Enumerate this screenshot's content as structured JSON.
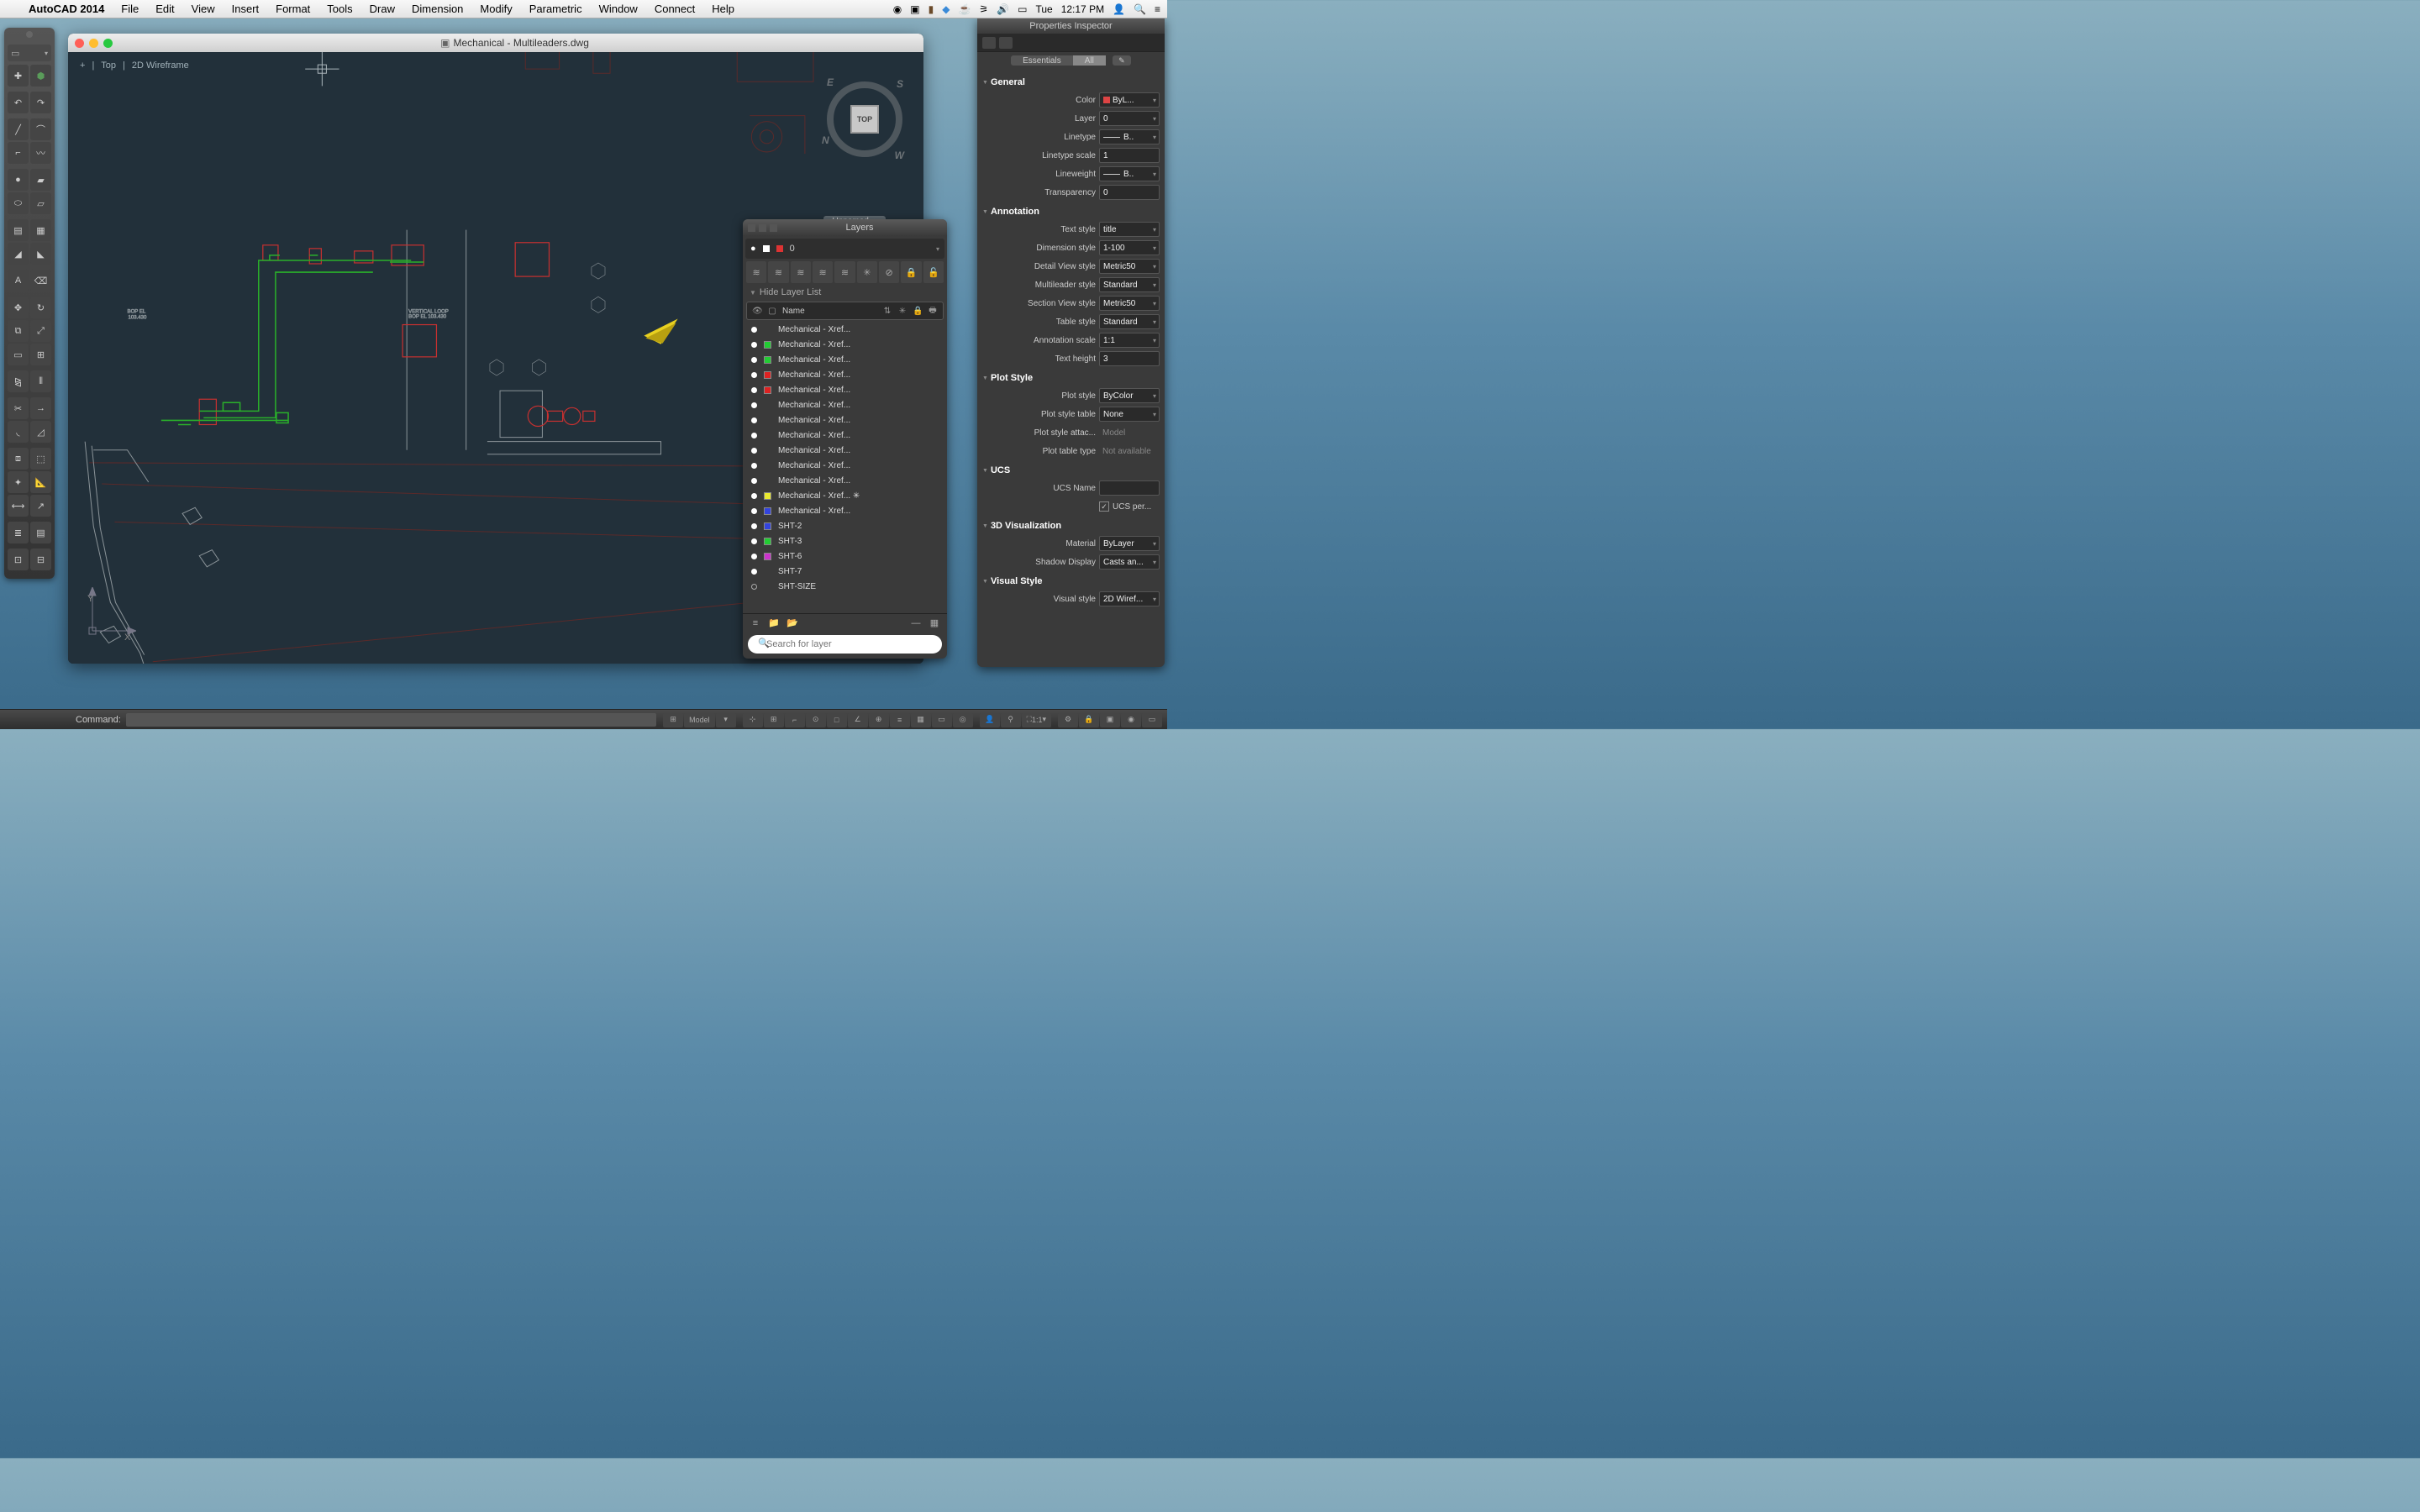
{
  "menubar": {
    "app_name": "AutoCAD 2014",
    "items": [
      "File",
      "Edit",
      "View",
      "Insert",
      "Format",
      "Tools",
      "Draw",
      "Dimension",
      "Modify",
      "Parametric",
      "Window",
      "Connect",
      "Help"
    ],
    "day": "Tue",
    "time": "12:17 PM"
  },
  "window": {
    "title": "Mechanical - Multileaders.dwg",
    "view_top": "Top",
    "view_style": "2D Wireframe",
    "viewcube_face": "TOP",
    "unnamed": "Unnamed"
  },
  "layers": {
    "title": "Layers",
    "current": "0",
    "collapser": "Hide Layer List",
    "column": "Name",
    "search_placeholder": "Search for layer",
    "items": [
      {
        "name": "Mechanical - Xref...",
        "color": "",
        "dot": "solid"
      },
      {
        "name": "Mechanical - Xref...",
        "color": "#22cc33",
        "dot": "solid"
      },
      {
        "name": "Mechanical - Xref...",
        "color": "#22cc33",
        "dot": "solid"
      },
      {
        "name": "Mechanical - Xref...",
        "color": "#dd2222",
        "dot": "solid"
      },
      {
        "name": "Mechanical - Xref...",
        "color": "#dd2222",
        "dot": "solid"
      },
      {
        "name": "Mechanical - Xref...",
        "color": "",
        "dot": "solid"
      },
      {
        "name": "Mechanical - Xref...",
        "color": "",
        "dot": "solid"
      },
      {
        "name": "Mechanical - Xref...",
        "color": "",
        "dot": "solid"
      },
      {
        "name": "Mechanical - Xref...",
        "color": "",
        "dot": "solid"
      },
      {
        "name": "Mechanical - Xref...",
        "color": "",
        "dot": "solid"
      },
      {
        "name": "Mechanical - Xref...",
        "color": "",
        "dot": "solid"
      },
      {
        "name": "Mechanical - Xref... ✳",
        "color": "#e8e830",
        "dot": "solid"
      },
      {
        "name": "Mechanical - Xref...",
        "color": "#3344dd",
        "dot": "solid"
      },
      {
        "name": "SHT-2",
        "color": "#3344dd",
        "dot": "solid"
      },
      {
        "name": "SHT-3",
        "color": "#22cc33",
        "dot": "solid"
      },
      {
        "name": "SHT-6",
        "color": "#cc33cc",
        "dot": "solid"
      },
      {
        "name": "SHT-7",
        "color": "",
        "dot": "solid"
      },
      {
        "name": "SHT-SIZE",
        "color": "",
        "dot": "hollow"
      }
    ]
  },
  "properties": {
    "title": "Properties Inspector",
    "tabs": {
      "essentials": "Essentials",
      "all": "All"
    },
    "sections": {
      "general": "General",
      "annotation": "Annotation",
      "plotstyle": "Plot Style",
      "ucs": "UCS",
      "viz3d": "3D Visualization",
      "visualstyle": "Visual Style"
    },
    "general": {
      "color_label": "Color",
      "color_val": "ByL...",
      "layer_label": "Layer",
      "layer_val": "0",
      "linetype_label": "Linetype",
      "linetype_val": "B..",
      "ltscale_label": "Linetype scale",
      "ltscale_val": "1",
      "lineweight_label": "Lineweight",
      "lineweight_val": "B..",
      "transparency_label": "Transparency",
      "transparency_val": "0"
    },
    "annotation": {
      "textstyle_label": "Text style",
      "textstyle_val": "title",
      "dimstyle_label": "Dimension style",
      "dimstyle_val": "1-100",
      "detailview_label": "Detail View style",
      "detailview_val": "Metric50",
      "mleader_label": "Multileader style",
      "mleader_val": "Standard",
      "sectionview_label": "Section View style",
      "sectionview_val": "Metric50",
      "tablestyle_label": "Table style",
      "tablestyle_val": "Standard",
      "annoscale_label": "Annotation scale",
      "annoscale_val": "1:1",
      "textheight_label": "Text height",
      "textheight_val": "3"
    },
    "plotstyle": {
      "plotstyle_label": "Plot style",
      "plotstyle_val": "ByColor",
      "plottable_label": "Plot style table",
      "plottable_val": "None",
      "plotattach_label": "Plot style attac...",
      "plotattach_val": "Model",
      "plottabletype_label": "Plot table type",
      "plottabletype_val": "Not available"
    },
    "ucs": {
      "ucsname_label": "UCS Name",
      "ucsname_val": "",
      "ucsper_label": "UCS per..."
    },
    "viz3d": {
      "material_label": "Material",
      "material_val": "ByLayer",
      "shadow_label": "Shadow Display",
      "shadow_val": "Casts an..."
    },
    "visualstyle": {
      "vs_label": "Visual style",
      "vs_val": "2D Wiref..."
    }
  },
  "cmdbar": {
    "label": "Command:",
    "model": "Model",
    "scale": "1:1"
  }
}
